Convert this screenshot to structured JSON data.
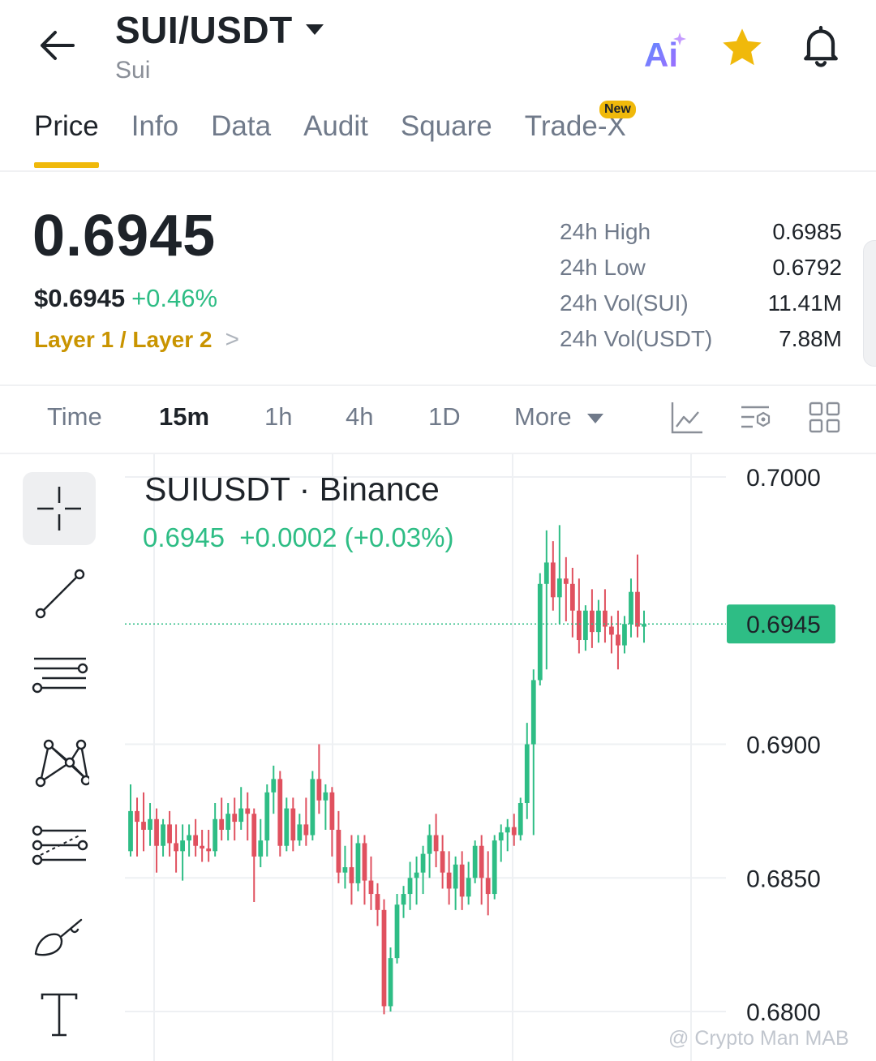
{
  "header": {
    "pair": "SUI/USDT",
    "subtitle": "Sui",
    "ai_label": "Ai",
    "icons": {
      "back": "back-arrow-icon",
      "dropdown": "caret-down-icon",
      "star": "star-icon",
      "bell": "bell-icon"
    }
  },
  "tabs": [
    {
      "label": "Price",
      "active": true
    },
    {
      "label": "Info"
    },
    {
      "label": "Data"
    },
    {
      "label": "Audit"
    },
    {
      "label": "Square"
    },
    {
      "label": "Trade-X",
      "badge": "New"
    }
  ],
  "price": {
    "last": "0.6945",
    "usd": "$0.6945",
    "change_pct": "+0.46%",
    "tag": "Layer 1 / Layer 2",
    "tag_chevron": ">"
  },
  "stats": [
    {
      "label": "24h High",
      "value": "0.6985"
    },
    {
      "label": "24h Low",
      "value": "0.6792"
    },
    {
      "label": "24h Vol(SUI)",
      "value": "11.41M"
    },
    {
      "label": "24h Vol(USDT)",
      "value": "7.88M"
    }
  ],
  "intervals": {
    "items": [
      "Time",
      "15m",
      "1h",
      "4h",
      "1D",
      "More"
    ],
    "active": "15m"
  },
  "chart_data": {
    "type": "candlestick",
    "title": "SUIUSDT · Binance",
    "quote": {
      "price": "0.6945",
      "change": "+0.0002",
      "change_pct": "(+0.03%)"
    },
    "price_tag": "0.6945",
    "y_ticks": [
      "0.7000",
      "0.6900",
      "0.6850",
      "0.6800"
    ],
    "ylim": [
      0.67815,
      0.70085
    ],
    "current_price": 0.6945,
    "colors": {
      "up": "#2ebd85",
      "down": "#e0515f",
      "grid": "#eef0f3"
    },
    "candles": [
      [
        0.686,
        0.6885,
        0.6858,
        0.6875
      ],
      [
        0.6875,
        0.688,
        0.6858,
        0.6871
      ],
      [
        0.6871,
        0.6882,
        0.686,
        0.6868
      ],
      [
        0.6868,
        0.6878,
        0.6862,
        0.6872
      ],
      [
        0.6872,
        0.6876,
        0.6852,
        0.6862
      ],
      [
        0.6862,
        0.6872,
        0.6858,
        0.687
      ],
      [
        0.687,
        0.6875,
        0.6858,
        0.6863
      ],
      [
        0.6863,
        0.687,
        0.6852,
        0.686
      ],
      [
        0.686,
        0.687,
        0.6849,
        0.6864
      ],
      [
        0.6864,
        0.687,
        0.6858,
        0.6866
      ],
      [
        0.6866,
        0.6872,
        0.6858,
        0.6862
      ],
      [
        0.6862,
        0.6868,
        0.6856,
        0.6861
      ],
      [
        0.6861,
        0.6868,
        0.6856,
        0.686
      ],
      [
        0.686,
        0.6878,
        0.6858,
        0.6872
      ],
      [
        0.6872,
        0.688,
        0.6864,
        0.6868
      ],
      [
        0.6868,
        0.6878,
        0.6864,
        0.6874
      ],
      [
        0.6874,
        0.688,
        0.6864,
        0.6871
      ],
      [
        0.6871,
        0.6884,
        0.6868,
        0.6876
      ],
      [
        0.6876,
        0.6882,
        0.6864,
        0.6874
      ],
      [
        0.6874,
        0.6876,
        0.6841,
        0.6858
      ],
      [
        0.6858,
        0.6872,
        0.6854,
        0.6864
      ],
      [
        0.6864,
        0.6885,
        0.6858,
        0.6882
      ],
      [
        0.6882,
        0.6892,
        0.6874,
        0.6887
      ],
      [
        0.6887,
        0.689,
        0.6858,
        0.6862
      ],
      [
        0.6862,
        0.688,
        0.686,
        0.6876
      ],
      [
        0.6876,
        0.688,
        0.686,
        0.6864
      ],
      [
        0.6864,
        0.6874,
        0.6862,
        0.687
      ],
      [
        0.687,
        0.688,
        0.6862,
        0.6866
      ],
      [
        0.6866,
        0.689,
        0.6864,
        0.6887
      ],
      [
        0.6887,
        0.69,
        0.6874,
        0.6879
      ],
      [
        0.6879,
        0.6885,
        0.6868,
        0.6882
      ],
      [
        0.6882,
        0.6884,
        0.6858,
        0.6868
      ],
      [
        0.6868,
        0.6875,
        0.6848,
        0.6852
      ],
      [
        0.6852,
        0.6862,
        0.6846,
        0.6854
      ],
      [
        0.6854,
        0.6866,
        0.684,
        0.6848
      ],
      [
        0.6848,
        0.6866,
        0.6845,
        0.6863
      ],
      [
        0.6863,
        0.6866,
        0.684,
        0.6849
      ],
      [
        0.6849,
        0.6858,
        0.6838,
        0.6844
      ],
      [
        0.6844,
        0.6848,
        0.6832,
        0.6838
      ],
      [
        0.6838,
        0.6842,
        0.6799,
        0.6802
      ],
      [
        0.6802,
        0.6824,
        0.68,
        0.682
      ],
      [
        0.682,
        0.6844,
        0.6818,
        0.684
      ],
      [
        0.684,
        0.6847,
        0.6835,
        0.6844
      ],
      [
        0.6844,
        0.6856,
        0.6838,
        0.685
      ],
      [
        0.685,
        0.6858,
        0.684,
        0.6852
      ],
      [
        0.6852,
        0.6862,
        0.6844,
        0.6859
      ],
      [
        0.6859,
        0.687,
        0.685,
        0.6866
      ],
      [
        0.6866,
        0.6874,
        0.6854,
        0.686
      ],
      [
        0.686,
        0.6866,
        0.6846,
        0.6852
      ],
      [
        0.6852,
        0.686,
        0.684,
        0.6846
      ],
      [
        0.6846,
        0.6858,
        0.6838,
        0.6855
      ],
      [
        0.6855,
        0.686,
        0.6838,
        0.6843
      ],
      [
        0.6843,
        0.6856,
        0.684,
        0.685
      ],
      [
        0.685,
        0.6864,
        0.6848,
        0.6862
      ],
      [
        0.6862,
        0.6866,
        0.684,
        0.685
      ],
      [
        0.685,
        0.686,
        0.6836,
        0.6844
      ],
      [
        0.6844,
        0.6866,
        0.6842,
        0.6864
      ],
      [
        0.6864,
        0.687,
        0.6856,
        0.6867
      ],
      [
        0.6867,
        0.6872,
        0.686,
        0.6869
      ],
      [
        0.6869,
        0.6874,
        0.6862,
        0.6866
      ],
      [
        0.6866,
        0.688,
        0.6864,
        0.6878
      ],
      [
        0.6878,
        0.6908,
        0.6872,
        0.69
      ],
      [
        0.69,
        0.6928,
        0.6866,
        0.6924
      ],
      [
        0.6924,
        0.6964,
        0.6922,
        0.696
      ],
      [
        0.696,
        0.698,
        0.6928,
        0.6968
      ],
      [
        0.6968,
        0.6976,
        0.695,
        0.6955
      ],
      [
        0.6955,
        0.6982,
        0.6945,
        0.6962
      ],
      [
        0.6962,
        0.697,
        0.6946,
        0.696
      ],
      [
        0.696,
        0.6966,
        0.694,
        0.695
      ],
      [
        0.695,
        0.6962,
        0.6934,
        0.6939
      ],
      [
        0.6939,
        0.6952,
        0.6935,
        0.695
      ],
      [
        0.695,
        0.6958,
        0.6936,
        0.6942
      ],
      [
        0.6942,
        0.6954,
        0.6938,
        0.695
      ],
      [
        0.695,
        0.6958,
        0.6938,
        0.6944
      ],
      [
        0.6944,
        0.6948,
        0.6934,
        0.6941
      ],
      [
        0.6941,
        0.695,
        0.6928,
        0.6937
      ],
      [
        0.6937,
        0.6948,
        0.6934,
        0.6945
      ],
      [
        0.6945,
        0.6962,
        0.694,
        0.6957
      ],
      [
        0.6957,
        0.6971,
        0.694,
        0.6944
      ],
      [
        0.6944,
        0.695,
        0.6938,
        0.6945
      ]
    ]
  },
  "watermark": "@ Crypto Man MAB"
}
